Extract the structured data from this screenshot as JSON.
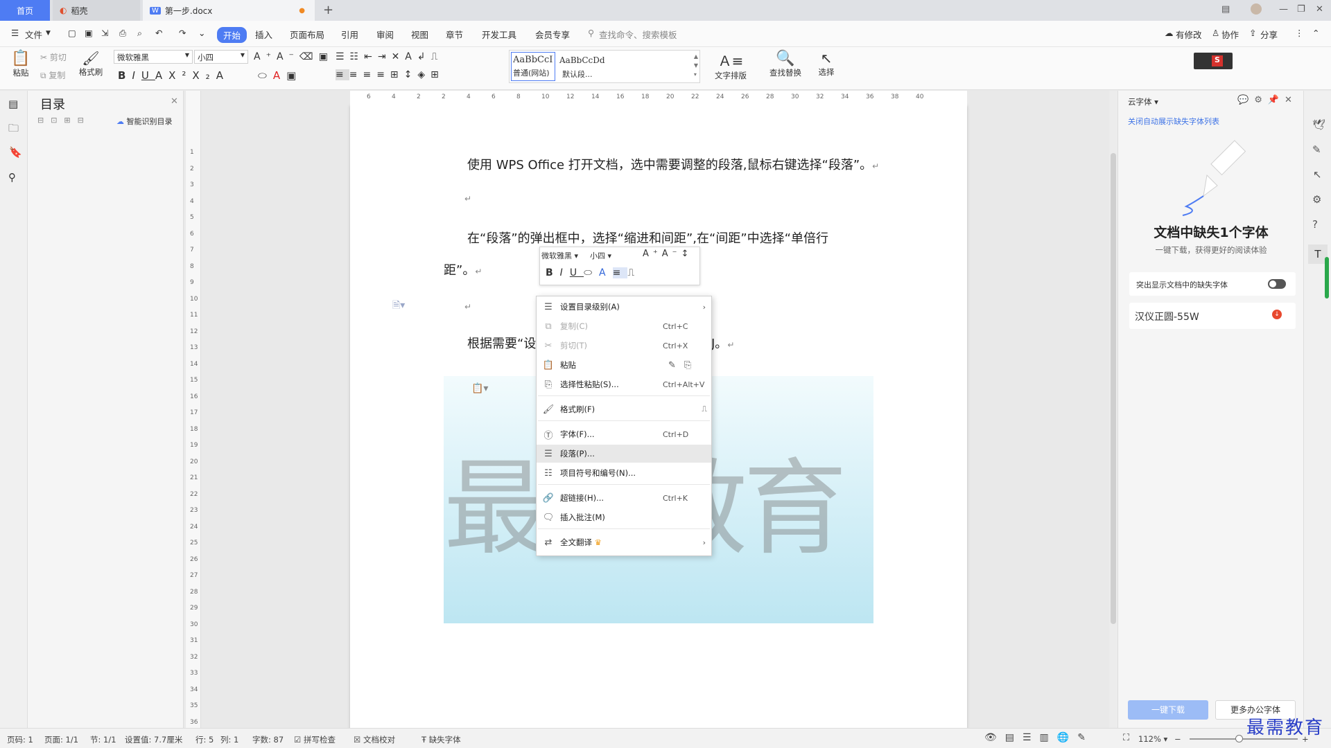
{
  "tabs": {
    "home": "首页",
    "daoke": "稻壳",
    "doc": "第一步.docx",
    "new_tab": "+"
  },
  "menu": {
    "file": "文件",
    "items": [
      "开始",
      "插入",
      "页面布局",
      "引用",
      "审阅",
      "视图",
      "章节",
      "开发工具",
      "会员专享"
    ],
    "search": "查找命令、搜索模板",
    "right": [
      "有修改",
      "协作",
      "分享"
    ]
  },
  "ribbon": {
    "paste": "粘贴",
    "cut": "剪切",
    "copy": "复制",
    "format_painter": "格式刷",
    "font_name": "微软雅黑",
    "font_size": "小四",
    "style1_preview": "AaBbCcI",
    "style1_name": "普通(网站)",
    "style2_preview": "AaBbCcDd",
    "style2_name": "默认段...",
    "text_layout": "文字排版",
    "find_replace": "查找替换",
    "select": "选择"
  },
  "toc": {
    "title": "目录",
    "smart": "智能识别目录"
  },
  "ruler": {
    "h": [
      "6",
      "4",
      "2",
      "2",
      "4",
      "6",
      "8",
      "10",
      "12",
      "14",
      "16",
      "18",
      "20",
      "22",
      "24",
      "26",
      "28",
      "30",
      "32",
      "34",
      "36",
      "38",
      "40"
    ],
    "v": [
      "1",
      "2",
      "3",
      "4",
      "5",
      "6",
      "7",
      "8",
      "9",
      "10",
      "11",
      "12",
      "13",
      "14",
      "15",
      "16",
      "17",
      "18",
      "19",
      "20",
      "21",
      "22",
      "23",
      "24",
      "25",
      "26",
      "27",
      "28",
      "29",
      "30",
      "31",
      "32",
      "33",
      "34",
      "35",
      "36"
    ]
  },
  "doc": {
    "p1": "使用 WPS Office 打开文档，选中需要调整的段落,鼠标右键选择“段落”。",
    "p2a": "在“段落”的弹出框中，选择“缩进和间距”,在“间距”中选择“单倍行",
    "p2b": "距”。",
    "p3a": "根据需要“设",
    "p3b": "J。",
    "return_mark": "↵",
    "watermark": "最需教育"
  },
  "floatbar": {
    "font": "微软雅黑",
    "size": "小四"
  },
  "context_menu": [
    {
      "label": "设置目录级别(A)",
      "shortcut": "",
      "icon": "toc-level-icon",
      "disabled": false,
      "arrow": true
    },
    {
      "label": "复制(C)",
      "shortcut": "Ctrl+C",
      "icon": "copy-icon",
      "disabled": true
    },
    {
      "label": "剪切(T)",
      "shortcut": "Ctrl+X",
      "icon": "cut-icon",
      "disabled": true
    },
    {
      "label": "粘贴",
      "shortcut": "",
      "icon": "paste-icon",
      "disabled": false
    },
    {
      "label": "选择性粘贴(S)...",
      "shortcut": "Ctrl+Alt+V",
      "icon": "paste-special-icon",
      "disabled": false
    },
    {
      "label": "格式刷(F)",
      "shortcut": "",
      "icon": "format-painter-icon",
      "disabled": false
    },
    {
      "label": "字体(F)...",
      "shortcut": "Ctrl+D",
      "icon": "font-icon",
      "disabled": false
    },
    {
      "label": "段落(P)...",
      "shortcut": "",
      "icon": "paragraph-icon",
      "disabled": false,
      "highlighted": true
    },
    {
      "label": "项目符号和编号(N)...",
      "shortcut": "",
      "icon": "bullet-list-icon",
      "disabled": false
    },
    {
      "label": "超链接(H)...",
      "shortcut": "Ctrl+K",
      "icon": "hyperlink-icon",
      "disabled": false
    },
    {
      "label": "插入批注(M)",
      "shortcut": "",
      "icon": "comment-icon",
      "disabled": false
    },
    {
      "label": "全文翻译",
      "shortcut": "",
      "icon": "translate-icon",
      "disabled": false,
      "arrow": true
    }
  ],
  "right_panel": {
    "title": "云字体",
    "close_link": "关闭自动展示缺失字体列表",
    "heading": "文档中缺失1个字体",
    "sub": "一键下载，获得更好的阅读体验",
    "toggle_label": "突出显示文档中的缺失字体",
    "font_item": "汉仪正圆-55W",
    "download_btn": "一键下载",
    "more_btn": "更多办公字体"
  },
  "status": {
    "page_no": "页码: 1",
    "pages": "页面: 1/1",
    "section": "节: 1/1",
    "setting": "设置值: 7.7厘米",
    "row": "行: 5",
    "col": "列: 1",
    "words": "字数: 87",
    "spell": "拼写检查",
    "proof": "文档校对",
    "missing_font": "缺失字体",
    "zoom": "112%"
  },
  "corner_watermark": "最需教育",
  "colors": {
    "accent": "#4e7cf3",
    "menu_highlight": "#e8e8e8"
  }
}
